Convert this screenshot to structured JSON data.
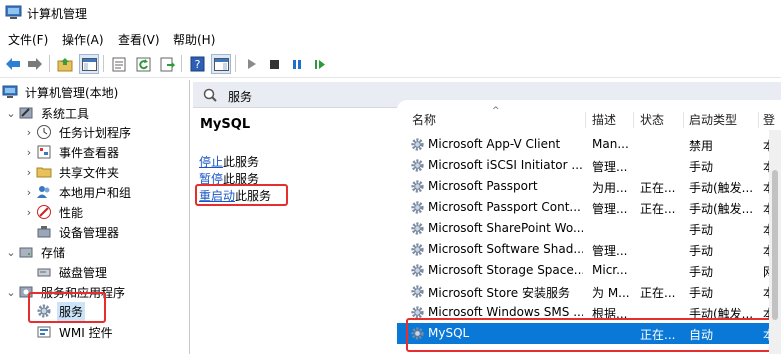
{
  "window": {
    "title": "计算机管理"
  },
  "menu": [
    "文件(F)",
    "操作(A)",
    "查看(V)",
    "帮助(H)"
  ],
  "toolbar": {
    "icons": [
      "back-arrow-icon",
      "forward-arrow-icon",
      "up-folder-icon",
      "console-tree-icon",
      "properties-icon",
      "refresh-icon",
      "export-icon",
      "help-icon",
      "show-hide-pane-icon",
      "start-service-icon",
      "stop-service-icon",
      "pause-service-icon",
      "resume-service-icon"
    ]
  },
  "tree": {
    "root": "计算机管理(本地)",
    "system_tools": "系统工具",
    "task_scheduler": "任务计划程序",
    "event_viewer": "事件查看器",
    "shared_folders": "共享文件夹",
    "local_users": "本地用户和组",
    "performance": "性能",
    "device_manager": "设备管理器",
    "storage": "存储",
    "disk_management": "磁盘管理",
    "services_apps": "服务和应用程序",
    "services": "服务",
    "wmi": "WMI 控件"
  },
  "services_header": {
    "title": "服务"
  },
  "description": {
    "service_name": "MySQL",
    "stop_link": "停止",
    "stop_rest": "此服务",
    "pause_link": "暂停",
    "pause_rest": "此服务",
    "restart_link": "重启动",
    "restart_rest": "此服务"
  },
  "table": {
    "columns": [
      "名称",
      "描述",
      "状态",
      "启动类型",
      "登"
    ],
    "rows": [
      {
        "name": "Microsoft App-V Client",
        "desc": "Man...",
        "status": "",
        "startup": "禁用",
        "logon": "本"
      },
      {
        "name": "Microsoft iSCSI Initiator ...",
        "desc": "管理...",
        "status": "",
        "startup": "手动",
        "logon": "本"
      },
      {
        "name": "Microsoft Passport",
        "desc": "为用...",
        "status": "正在...",
        "startup": "手动(触发...",
        "logon": "本"
      },
      {
        "name": "Microsoft Passport Cont...",
        "desc": "管理...",
        "status": "正在...",
        "startup": "手动(触发...",
        "logon": "本"
      },
      {
        "name": "Microsoft SharePoint Wo...",
        "desc": "",
        "status": "",
        "startup": "手动",
        "logon": "本"
      },
      {
        "name": "Microsoft Software Shad...",
        "desc": "管理...",
        "status": "",
        "startup": "手动",
        "logon": "本"
      },
      {
        "name": "Microsoft Storage Space...",
        "desc": "Micr...",
        "status": "",
        "startup": "手动",
        "logon": "网"
      },
      {
        "name": "Microsoft Store 安装服务",
        "desc": "为 M...",
        "status": "正在...",
        "startup": "手动",
        "logon": "本"
      },
      {
        "name": "Microsoft Windows SMS ...",
        "desc": "根据...",
        "status": "",
        "startup": "手动(触发...",
        "logon": "本"
      },
      {
        "name": "MySQL",
        "desc": "",
        "status": "正在...",
        "startup": "自动",
        "logon": "本"
      }
    ],
    "selected_index": 9
  },
  "colors": {
    "selection": "#0a78d7",
    "highlight_box": "#e62e2e",
    "link": "#1a55c5"
  }
}
